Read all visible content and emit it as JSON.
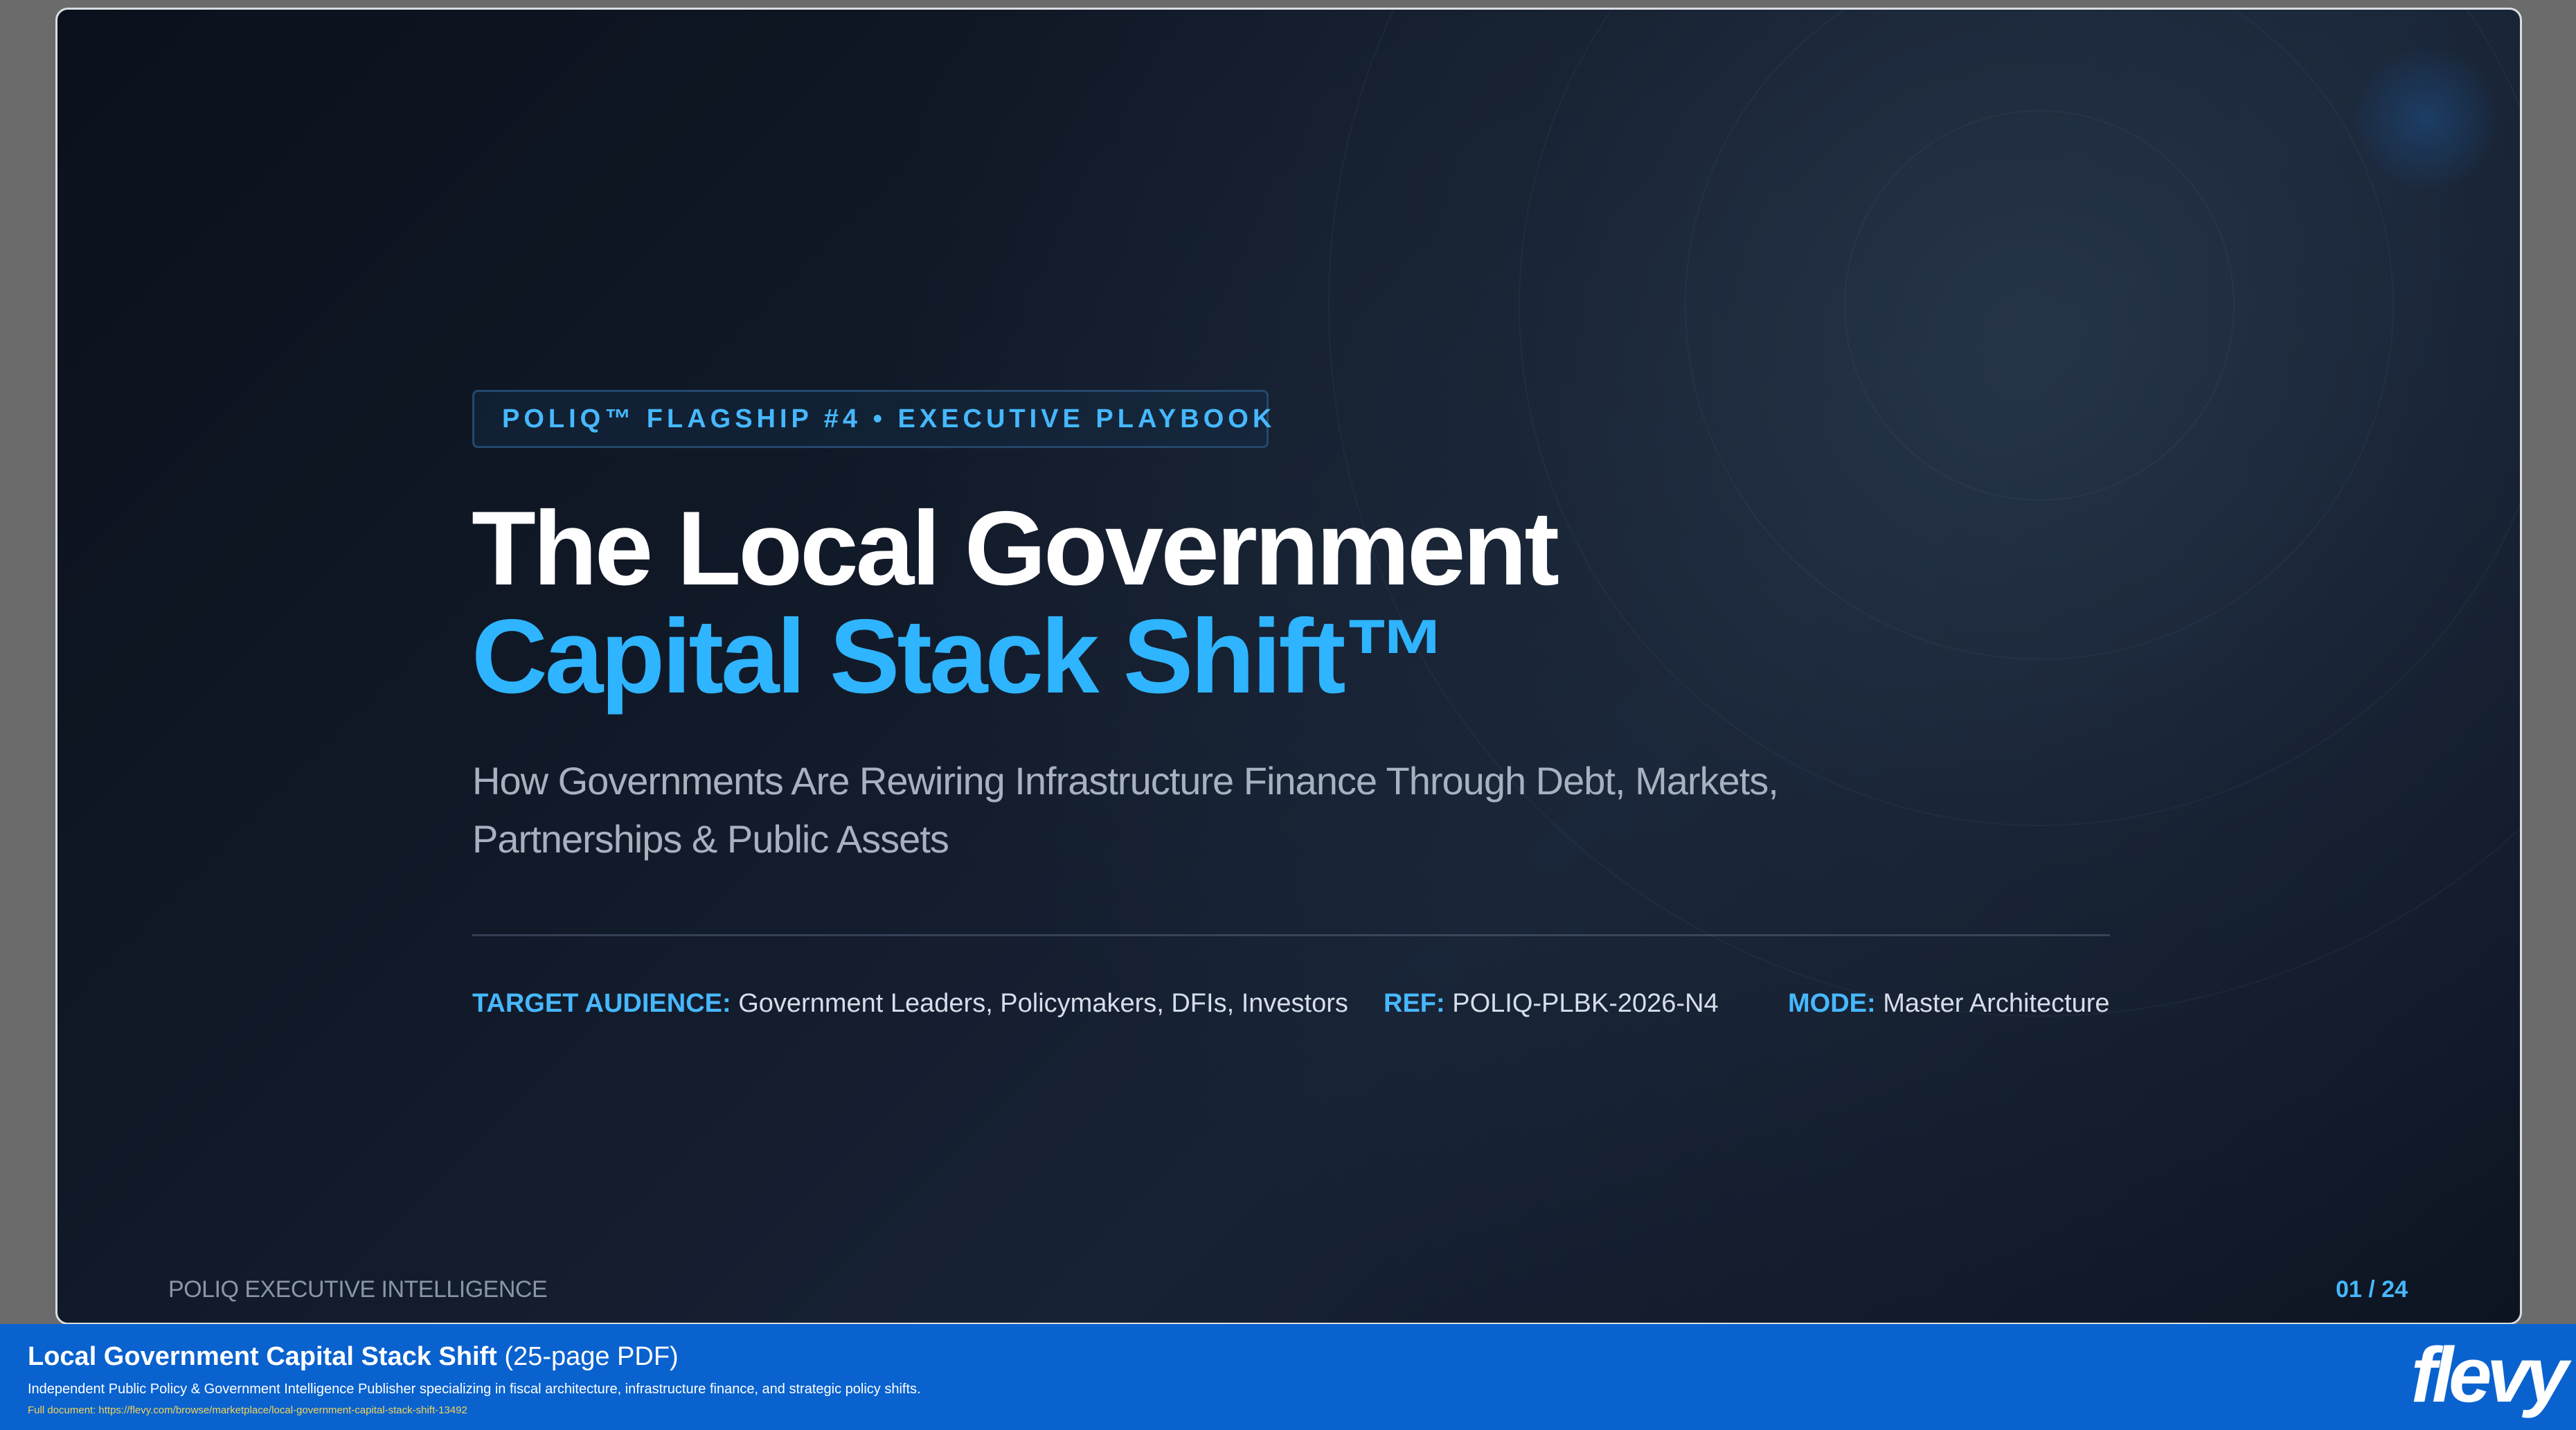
{
  "slide": {
    "eyebrow": "POLIQ™ FLAGSHIP #4 • EXECUTIVE PLAYBOOK",
    "title_line_1": "The Local Government",
    "title_line_2": "Capital Stack Shift™",
    "subtitle": "How Governments Are Rewiring Infrastructure Finance Through Debt, Markets, Partnerships & Public Assets",
    "meta": {
      "audience_label": "TARGET AUDIENCE:",
      "audience_value": "Government Leaders, Policymakers, DFIs, Investors",
      "ref_label": "REF:",
      "ref_value": "POLIQ-PLBK-2026-N4",
      "mode_label": "MODE:",
      "mode_value": "Master Architecture"
    },
    "footer_left": "POLIQ EXECUTIVE INTELLIGENCE",
    "page_number": "01 / 24"
  },
  "banner": {
    "title": "Local Government Capital Stack Shift",
    "page_count": "(25-page PDF)",
    "description": "Independent Public Policy & Government Intelligence Publisher specializing in fiscal architecture, infrastructure finance, and strategic policy shifts.",
    "link_label": "Full document:",
    "link_url": "https://flevy.com/browse/marketplace/local-government-capital-stack-shift-13492",
    "brand": "flevy"
  },
  "colors": {
    "accent": "#2fb4ff",
    "banner": "#0962ce",
    "background": "#0f1725"
  }
}
